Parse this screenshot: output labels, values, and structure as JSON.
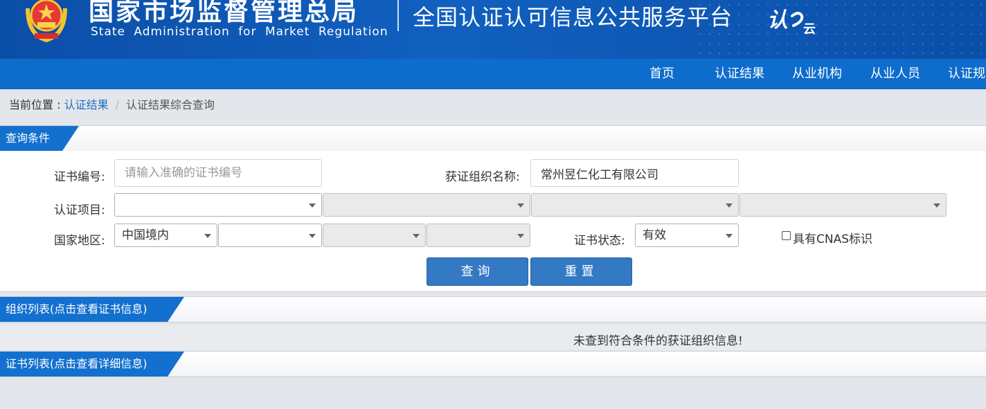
{
  "header": {
    "org_cn": "国家市场监督管理总局",
    "org_en": "State Administration  for  Market Regulation",
    "platform": "全国认证认可信息公共服务平台",
    "logo_main": "认",
    "logo_sub": "云"
  },
  "nav": {
    "items": [
      "首页",
      "认证结果",
      "从业机构",
      "从业人员",
      "认证规"
    ]
  },
  "breadcrumb": {
    "label": "当前位置 : ",
    "link": "认证结果",
    "separator": "/",
    "current": "认证结果综合查询"
  },
  "query_section": {
    "title": "查询条件"
  },
  "form": {
    "cert_no_label": "证书编号:",
    "cert_no_placeholder": "请输入准确的证书编号",
    "org_name_label": "获证组织名称:",
    "org_name_value": "常州昱仁化工有限公司",
    "project_label": "认证项目:",
    "region_label": "国家地区:",
    "region_value": "中国境内",
    "status_label": "证书状态:",
    "status_value": "有效",
    "cnas_label": "具有CNAS标识",
    "cnas_checked": false,
    "search_button": "查询",
    "reset_button": "重置"
  },
  "org_list": {
    "title": "组织列表(点击查看证书信息)",
    "empty_message": "未查到符合条件的获证组织信息!"
  },
  "cert_list": {
    "title": "证书列表(点击查看详细信息)"
  },
  "colors": {
    "header_blue": "#0b4ea8",
    "nav_blue": "#0e6ccd",
    "tag_blue": "#1370cf",
    "button_blue": "#3379c4",
    "link_blue": "#1d6fc4"
  }
}
